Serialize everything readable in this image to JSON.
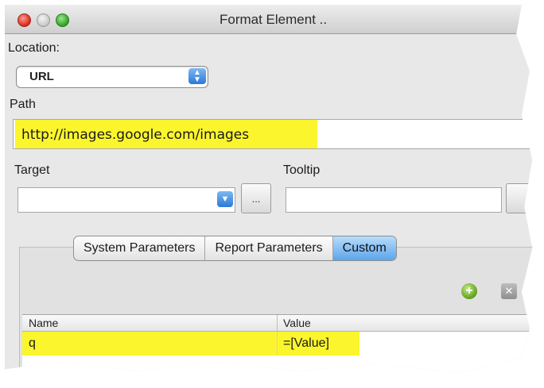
{
  "window": {
    "title": "Format Element .."
  },
  "location": {
    "label": "Location:",
    "selected": "URL"
  },
  "path": {
    "label": "Path",
    "value": "http://images.google.com/images"
  },
  "target": {
    "label": "Target",
    "value": "",
    "browse_label": "..."
  },
  "tooltip": {
    "label": "Tooltip",
    "value": ""
  },
  "tabs": [
    {
      "label": "System Parameters",
      "active": false
    },
    {
      "label": "Report Parameters",
      "active": false
    },
    {
      "label": "Custom",
      "active": true
    }
  ],
  "parameters_table": {
    "columns": [
      "Name",
      "Value"
    ],
    "rows": [
      {
        "name": "q",
        "value": "=[Value]"
      }
    ]
  },
  "colors": {
    "highlight": "#fbf52d",
    "accent": "#5ca5ec"
  }
}
